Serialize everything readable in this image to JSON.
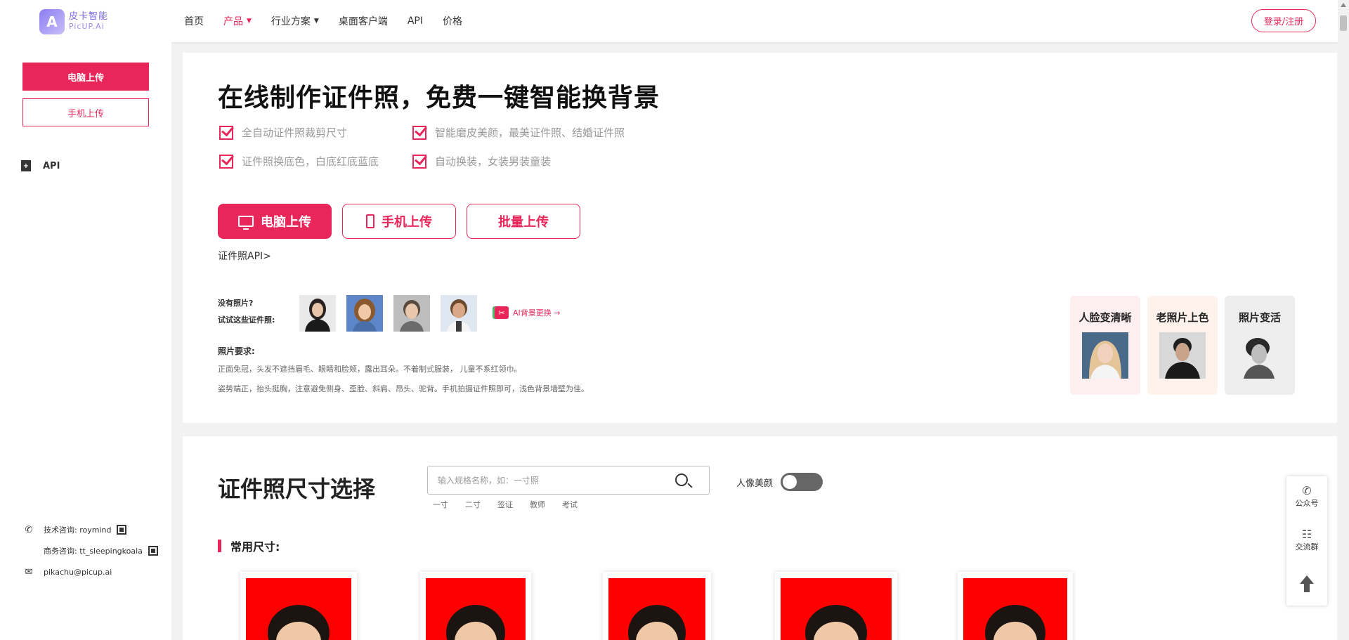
{
  "header": {
    "logo_cn": "皮卡智能",
    "logo_en": "PicUP.Ai",
    "nav": [
      {
        "label": "首页",
        "dropdown": false,
        "active": false
      },
      {
        "label": "产品",
        "dropdown": true,
        "active": true
      },
      {
        "label": "行业方案",
        "dropdown": true,
        "active": false
      },
      {
        "label": "桌面客户端",
        "dropdown": false,
        "active": false
      },
      {
        "label": "API",
        "dropdown": false,
        "active": false
      },
      {
        "label": "价格",
        "dropdown": false,
        "active": false
      }
    ],
    "login_label": "登录/注册"
  },
  "sidebar": {
    "upload_pc": "电脑上传",
    "upload_mobile": "手机上传",
    "api_label": "API",
    "contacts": {
      "tech": "技术咨询: roymind",
      "business": "商务咨询: tt_sleepingkoala",
      "email": "pikachu@picup.ai"
    }
  },
  "hero": {
    "title": "在线制作证件照，免费一键智能换背景",
    "features": [
      "全自动证件照裁剪尺寸",
      "智能磨皮美颜，最美证件照、结婚证件照",
      "证件照换底色，白底红底蓝底",
      "自动换装，女装男装童装"
    ],
    "buttons": {
      "pc": "电脑上传",
      "mobile": "手机上传",
      "batch": "批量上传"
    },
    "api_link": "证件照API>",
    "try_line1": "没有照片?",
    "try_line2": "试试这些证件照:",
    "ai_bg_link": "AI背景更换 →",
    "requirements_title": "照片要求:",
    "requirements": [
      "正面免冠，头发不遮挡眉毛、眼睛和脸颊，露出耳朵。不着制式服装， 儿童不系红领巾。",
      "姿势端正，抬头挺胸，注意避免侧身、歪脸、斜肩、昂头、驼背。手机拍摄证件照即可，浅色背景墙壁为佳。"
    ],
    "promos": [
      {
        "title": "人脸变清晰",
        "bg": "#fdeef0"
      },
      {
        "title": "老照片上色",
        "bg": "#fdf3ec"
      },
      {
        "title": "照片变活",
        "bg": "#ededed"
      }
    ]
  },
  "sizes": {
    "title": "证件照尺寸选择",
    "search_placeholder": "输入规格名称，如：一寸照",
    "tags": [
      "一寸",
      "二寸",
      "签证",
      "教师",
      "考试"
    ],
    "beauty_label": "人像美颜",
    "common_label": "常用尺寸:",
    "card_bg": "#ff0000"
  },
  "float": {
    "wechat": "公众号",
    "group": "交流群"
  },
  "colors": {
    "accent": "#e8265a"
  }
}
